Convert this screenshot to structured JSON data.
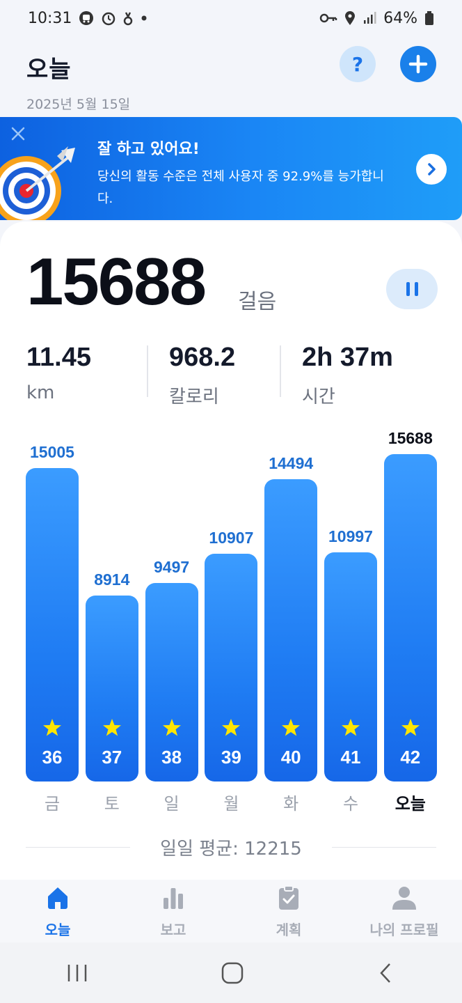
{
  "status_bar": {
    "time": "10:31",
    "battery": "64%",
    "icons": [
      "bus-icon",
      "alarm-icon",
      "fitness-icon",
      "dot-icon",
      "key-icon",
      "location-icon",
      "signal-icon",
      "battery-icon"
    ]
  },
  "header": {
    "title": "오늘",
    "date": "2025년 5월 15일",
    "help_label": "?",
    "add_icon": "plus-icon"
  },
  "banner": {
    "title": "잘 하고 있어요!",
    "text": "당신의 활동 수준은 전체 사용자 중 92.9%를 능가합니다.",
    "icons": [
      "close-icon",
      "target-icon",
      "chevron-right-icon"
    ]
  },
  "summary": {
    "steps": "15688",
    "steps_unit": "걸음",
    "pause_icon": "pause-icon",
    "metrics": [
      {
        "value": "11.45",
        "unit": "km"
      },
      {
        "value": "968.2",
        "unit": "칼로리"
      },
      {
        "value": "2h 37m",
        "unit": "시간"
      }
    ]
  },
  "chart_data": {
    "type": "bar",
    "categories": [
      "금",
      "토",
      "일",
      "월",
      "화",
      "수",
      "오늘"
    ],
    "values": [
      15005,
      8914,
      9497,
      10907,
      14494,
      10997,
      15688
    ],
    "badges": [
      "36",
      "37",
      "38",
      "39",
      "40",
      "41",
      "42"
    ],
    "highlight_index": 6,
    "colors": {
      "bar": "#1f7cf3",
      "value_text": "#1f6fd1",
      "today_text": "#0c0f18",
      "star": "#ffe600"
    }
  },
  "average": {
    "text": "일일 평균: 12215"
  },
  "bottom_nav": {
    "items": [
      {
        "label": "오늘",
        "icon": "home-icon",
        "active": true
      },
      {
        "label": "보고",
        "icon": "bar-chart-icon",
        "active": false
      },
      {
        "label": "계획",
        "icon": "clipboard-check-icon",
        "active": false
      },
      {
        "label": "나의 프로필",
        "icon": "person-icon",
        "active": false
      }
    ]
  },
  "system_nav": {
    "icons": [
      "recents-icon",
      "home-button-icon",
      "back-icon"
    ]
  }
}
